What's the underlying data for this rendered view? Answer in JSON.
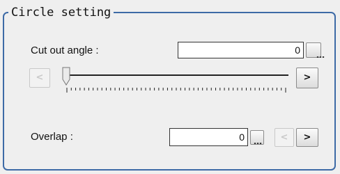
{
  "panel": {
    "title": "Circle setting"
  },
  "cut_out_angle": {
    "label": "Cut out angle :",
    "value": "0",
    "ellipsis_label": "...",
    "slider_level": 0,
    "decrement_label": "<",
    "increment_label": ">",
    "decrement_enabled": false
  },
  "overlap": {
    "label": "Overlap :",
    "value": "0",
    "ellipsis_label": "...",
    "decrement_label": "<",
    "increment_label": ">",
    "decrement_enabled": false
  },
  "icons": {
    "ellipsis": "ellipsis-icon",
    "slider_thumb": "slider-thumb-icon"
  }
}
